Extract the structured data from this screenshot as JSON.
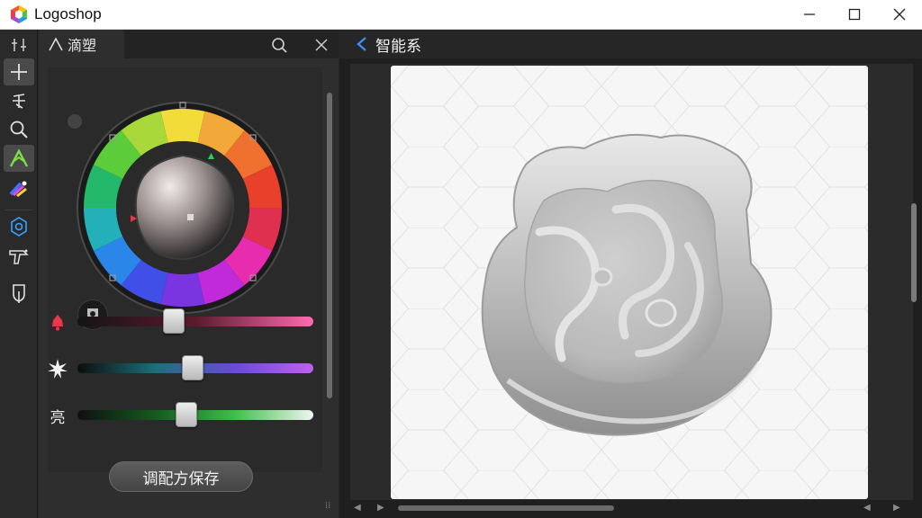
{
  "app": {
    "title": "Logoshop",
    "logo_icon": "logoshop-hexagon-icon"
  },
  "window_controls": {
    "minimize": "minimize-icon",
    "maximize": "maximize-icon",
    "close": "close-icon"
  },
  "toolbar": {
    "tools": [
      {
        "name": "drag-handle-icon",
        "active": false
      },
      {
        "name": "move-crosshair-icon",
        "active": true
      },
      {
        "name": "text-tool-icon",
        "active": false
      },
      {
        "name": "zoom-icon",
        "active": false
      },
      {
        "name": "eyedropper-icon",
        "active": true
      },
      {
        "name": "palette-icon",
        "active": false
      },
      {
        "name": "settings-gear-icon",
        "active": false
      },
      {
        "name": "brush-tool-icon",
        "active": false
      },
      {
        "name": "shield-tool-icon",
        "active": false
      }
    ]
  },
  "panel": {
    "tab_label": "滴塑",
    "tab_icon": "eyedropper-icon",
    "search_icon": "search-icon",
    "close_icon": "close-icon",
    "sliders": [
      {
        "icon": "bell-icon",
        "label": "",
        "value": 0.41,
        "gradient": [
          "#141414",
          "#5a1a2c",
          "#ff6bb0"
        ]
      },
      {
        "icon": "sparkle-icon",
        "label": "",
        "value": 0.49,
        "gradient": [
          "#0d0d0d",
          "#1d6f7a",
          "#6a4ad8",
          "#c060f0"
        ]
      },
      {
        "icon": "",
        "label": "亮",
        "value": 0.46,
        "gradient": [
          "#0f0f0f",
          "#155a20",
          "#3fbf4a",
          "#f0f6f0"
        ]
      }
    ],
    "save_button": "调配方保存",
    "harmony_icon": "harmony-shield-icon"
  },
  "canvas": {
    "back_icon": "chevron-left-icon",
    "title": "智能系"
  },
  "colors": {
    "accent_blue": "#3a8df5",
    "panel_bg": "#2e2e2e",
    "artboard_bg": "#f6f6f6"
  }
}
